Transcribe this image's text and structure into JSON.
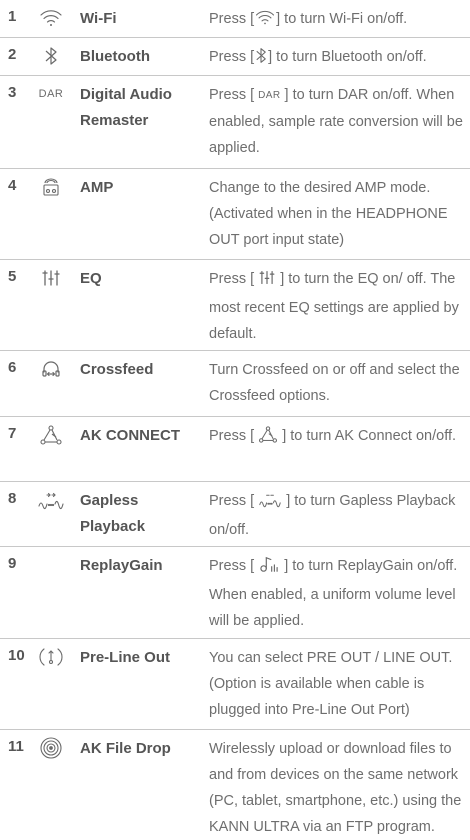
{
  "rows": [
    {
      "num": "1",
      "icon": "wifi-icon",
      "name": "Wi-Fi",
      "desc_pre": "Press [",
      "desc_post": "] to turn Wi-Fi on/off."
    },
    {
      "num": "2",
      "icon": "bluetooth-icon",
      "name": "Bluetooth",
      "desc_pre": "Press [",
      "desc_post": "] to turn Bluetooth on/off."
    },
    {
      "num": "3",
      "icon": "dar-icon",
      "icon_text": "DAR",
      "name": "Digital Audio Remaster",
      "desc_pre": "Press [",
      "desc_post": "] to turn DAR on/off. When enabled, sample rate conversion will be applied."
    },
    {
      "num": "4",
      "icon": "amp-icon",
      "name": "AMP",
      "desc": "Change to the desired AMP mode. (Activated when in the HEADPHONE OUT port input state)"
    },
    {
      "num": "5",
      "icon": "eq-icon",
      "name": "EQ",
      "desc_pre": "Press [",
      "desc_post": "] to turn the EQ on/ off. The most recent EQ settings are applied by default."
    },
    {
      "num": "6",
      "icon": "crossfeed-icon",
      "name": "Crossfeed",
      "desc": "Turn Crossfeed on or off and select the Crossfeed options."
    },
    {
      "num": "7",
      "icon": "ak-connect-icon",
      "name": "AK CONNECT",
      "desc_pre": "Press [",
      "desc_post": "] to turn AK Connect on/off."
    },
    {
      "num": "8",
      "icon": "gapless-icon",
      "name": "Gapless Playback",
      "desc_pre": "Press [",
      "desc_post": "] to turn Gapless Playback on/off."
    },
    {
      "num": "9",
      "icon": "replaygain-icon",
      "name": "ReplayGain",
      "desc_pre": "Press [",
      "desc_post": "] to turn ReplayGain on/off. When enabled, a uniform volume level will be applied."
    },
    {
      "num": "10",
      "icon": "pre-line-out-icon",
      "name": "Pre-Line Out",
      "desc": "You can select PRE OUT / LINE OUT. (Option is available when cable is plugged into Pre-Line Out Port)"
    },
    {
      "num": "11",
      "icon": "file-drop-icon",
      "name": "AK File Drop",
      "desc": "Wirelessly upload or download files to and from devices on the same network (PC, tablet, smartphone, etc.) using the KANN ULTRA via an FTP program."
    }
  ]
}
